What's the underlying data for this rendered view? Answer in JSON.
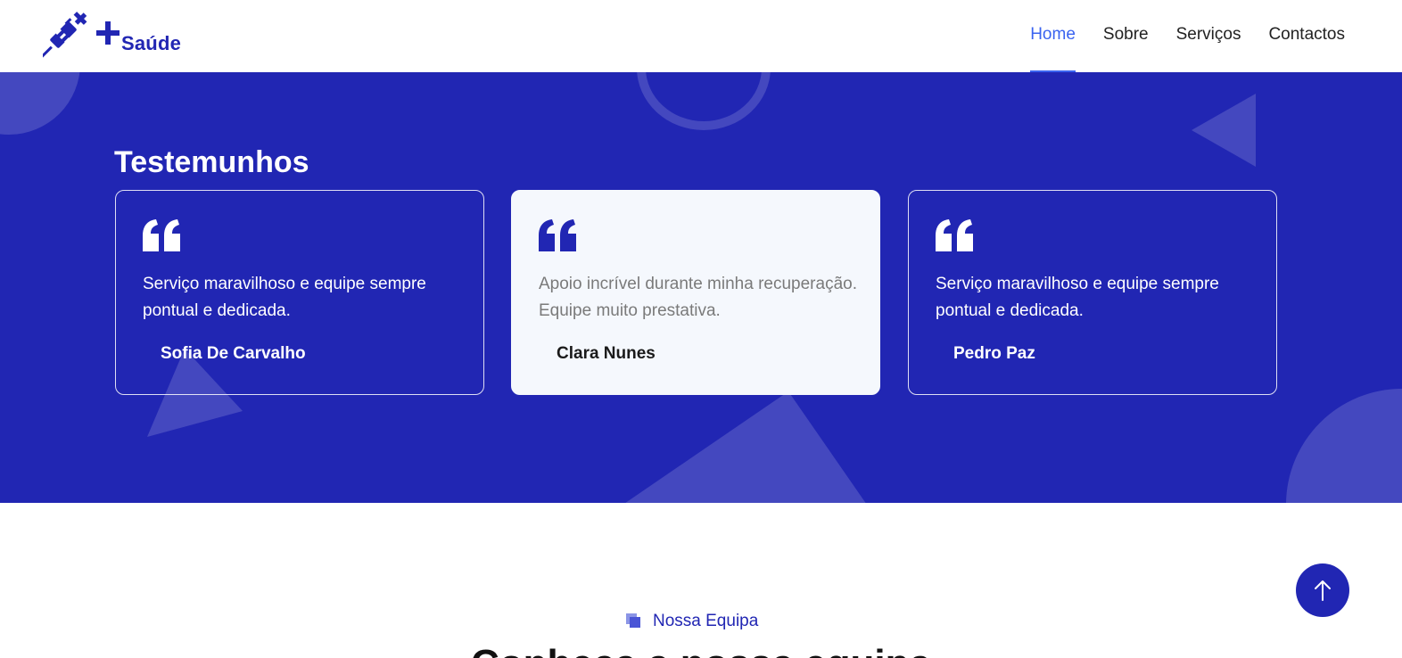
{
  "brand": {
    "name": "Saúde",
    "primary_color": "#2126b3",
    "link_active_color": "#3a63f0",
    "icon": "syringe-icon"
  },
  "nav": {
    "items": [
      {
        "label": "Home",
        "active": true
      },
      {
        "label": "Sobre",
        "active": false
      },
      {
        "label": "Serviços",
        "active": false
      },
      {
        "label": "Contactos",
        "active": false
      }
    ]
  },
  "testimonials": {
    "title": "Testemunhos",
    "items": [
      {
        "text": "Serviço maravilhoso e equipe sempre pontual e dedicada.",
        "author": "Sofia De Carvalho"
      },
      {
        "text": "Apoio incrível durante minha recuperação. Equipe muito prestativa.",
        "author": "Clara Nunes"
      },
      {
        "text": "Serviço maravilhoso e equipe sempre pontual e dedicada.",
        "author": "Pedro Paz"
      }
    ]
  },
  "team": {
    "tag": "Nossa Equipa",
    "heading": "Conheça a nossa equipa"
  },
  "back_to_top": {
    "icon": "arrow-up-icon"
  }
}
